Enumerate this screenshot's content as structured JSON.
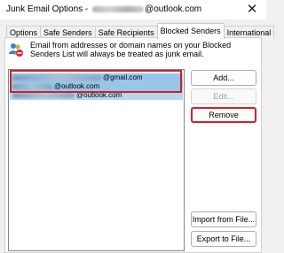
{
  "window": {
    "title_prefix": "Junk Email Options - ",
    "title_suffix": "@outlook.com",
    "close_glyph": "✕"
  },
  "tabs": [
    {
      "label": "Options"
    },
    {
      "label": "Safe Senders"
    },
    {
      "label": "Safe Recipients"
    },
    {
      "label": "Blocked Senders",
      "active": true
    },
    {
      "label": "International"
    }
  ],
  "blocked": {
    "description": "Email from addresses or domain names on your Blocked Senders List will always be treated as junk email.",
    "icon": "blocked-users-icon",
    "entries": [
      {
        "domain": "@gmail.com"
      },
      {
        "domain": "@outlook.com"
      },
      {
        "domain": "@outlook.com"
      }
    ]
  },
  "buttons": {
    "add": "Add...",
    "edit": "Edit...",
    "remove": "Remove",
    "import": "Import from File...",
    "export": "Export to File..."
  },
  "colors": {
    "selection": "#98c6e8",
    "highlight_border": "#d0202a"
  }
}
